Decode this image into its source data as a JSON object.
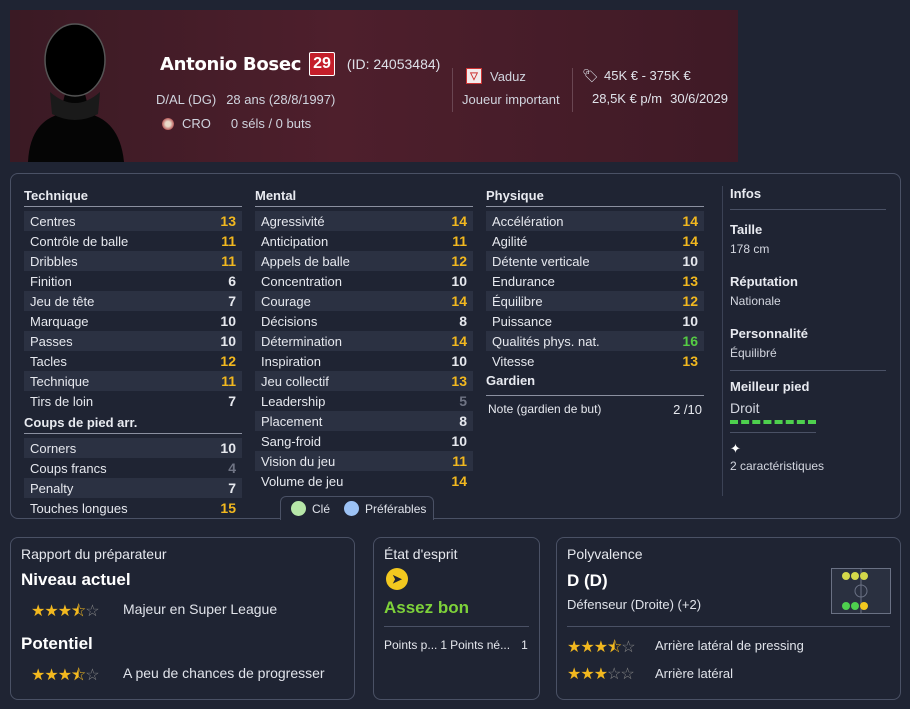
{
  "player": {
    "name": "Antonio Bosec",
    "number": "29",
    "id": "(ID: 24053484)",
    "position": "D/AL (DG)",
    "age": "28 ans (28/8/1997)",
    "nationality": "CRO",
    "caps": "0 séls / 0 buts"
  },
  "club": {
    "name": "Vaduz",
    "status": "Joueur important"
  },
  "value": {
    "range": "45K € - 375K €",
    "wage": "28,5K € p/m",
    "contract": "30/6/2029"
  },
  "colors": {
    "accent": "#f2b81f",
    "top": "#55cc44",
    "low": "#6f7484",
    "header": "#4e1f2c"
  },
  "technique": {
    "title": "Technique",
    "items": [
      {
        "label": "Centres",
        "value": "13"
      },
      {
        "label": "Contrôle de balle",
        "value": "11"
      },
      {
        "label": "Dribbles",
        "value": "11"
      },
      {
        "label": "Finition",
        "value": "6"
      },
      {
        "label": "Jeu de tête",
        "value": "7"
      },
      {
        "label": "Marquage",
        "value": "10"
      },
      {
        "label": "Passes",
        "value": "10"
      },
      {
        "label": "Tacles",
        "value": "12"
      },
      {
        "label": "Technique",
        "value": "11"
      },
      {
        "label": "Tirs de loin",
        "value": "7"
      }
    ]
  },
  "set_pieces": {
    "title": "Coups de pied arr.",
    "items": [
      {
        "label": "Corners",
        "value": "10"
      },
      {
        "label": "Coups francs",
        "value": "4"
      },
      {
        "label": "Penalty",
        "value": "7"
      },
      {
        "label": "Touches longues",
        "value": "15"
      }
    ]
  },
  "mental": {
    "title": "Mental",
    "items": [
      {
        "label": "Agressivité",
        "value": "14"
      },
      {
        "label": "Anticipation",
        "value": "11"
      },
      {
        "label": "Appels de balle",
        "value": "12"
      },
      {
        "label": "Concentration",
        "value": "10"
      },
      {
        "label": "Courage",
        "value": "14"
      },
      {
        "label": "Décisions",
        "value": "8"
      },
      {
        "label": "Détermination",
        "value": "14"
      },
      {
        "label": "Inspiration",
        "value": "10"
      },
      {
        "label": "Jeu collectif",
        "value": "13"
      },
      {
        "label": "Leadership",
        "value": "5"
      },
      {
        "label": "Placement",
        "value": "8"
      },
      {
        "label": "Sang-froid",
        "value": "10"
      },
      {
        "label": "Vision du jeu",
        "value": "11"
      },
      {
        "label": "Volume de jeu",
        "value": "14"
      }
    ]
  },
  "physical": {
    "title": "Physique",
    "items": [
      {
        "label": "Accélération",
        "value": "14"
      },
      {
        "label": "Agilité",
        "value": "14"
      },
      {
        "label": "Détente verticale",
        "value": "10"
      },
      {
        "label": "Endurance",
        "value": "13"
      },
      {
        "label": "Équilibre",
        "value": "12"
      },
      {
        "label": "Puissance",
        "value": "10"
      },
      {
        "label": "Qualités phys. nat.",
        "value": "16"
      },
      {
        "label": "Vitesse",
        "value": "13"
      }
    ]
  },
  "goalkeeper": {
    "title": "Gardien",
    "label": "Note (gardien de but)",
    "value": "2 /10"
  },
  "legend": {
    "key": "Clé",
    "preferred": "Préférables"
  },
  "info": {
    "title": "Infos",
    "height_label": "Taille",
    "height": "178 cm",
    "reputation_label": "Réputation",
    "reputation": "Nationale",
    "personality_label": "Personnalité",
    "personality": "Équilibré",
    "foot_label": "Meilleur pied",
    "foot": "Droit",
    "traits": "2 caractéristiques"
  },
  "coach_report": {
    "title": "Rapport du préparateur",
    "current_label": "Niveau actuel",
    "current_stars": 3.5,
    "current_text": "Majeur en Super League",
    "potential_label": "Potentiel",
    "potential_stars": 3.5,
    "potential_text": "A peu de chances de progresser"
  },
  "mood": {
    "title": "État d'esprit",
    "value": "Assez bon",
    "points_a": "Points p...",
    "points_a_val": "1",
    "points_b": "Points né...",
    "points_b_val": "1"
  },
  "versatility": {
    "title": "Polyvalence",
    "position": "D (D)",
    "description": "Défenseur (Droite) (+2)",
    "roles": [
      {
        "label": "Arrière latéral de pressing",
        "stars": 3.5
      },
      {
        "label": "Arrière latéral",
        "stars": 3
      }
    ]
  }
}
